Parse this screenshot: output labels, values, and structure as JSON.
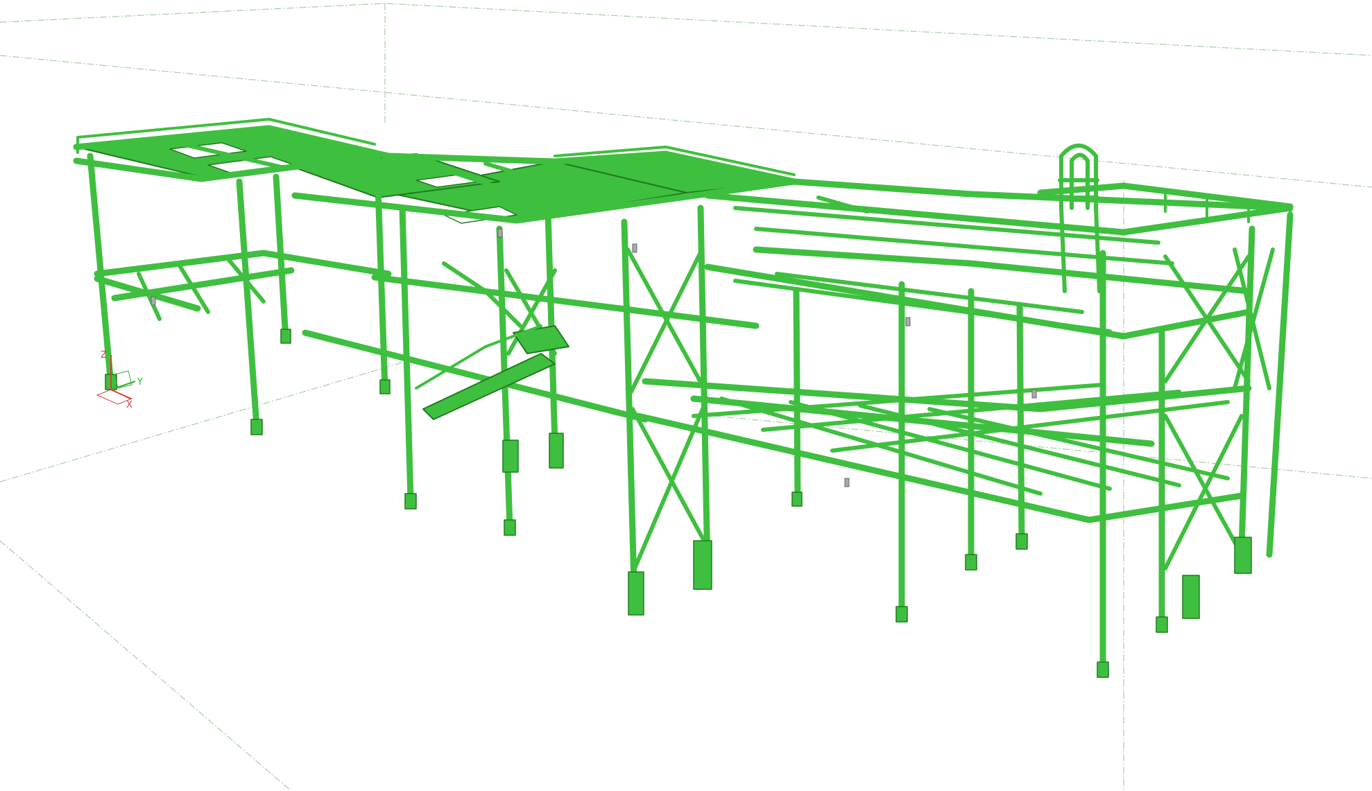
{
  "viewport": {
    "background": "#ffffff",
    "model_color": "#3fbf3f",
    "model_edge_color": "#1f7a1f",
    "model_shade_color": "#2e9e2e",
    "bounding_box_color": "#a6cca6"
  },
  "axis_triad": {
    "z_label": "Z",
    "y_label": "Y",
    "x_label": "X",
    "z_color": "#d04040",
    "y_color": "#30b030",
    "x_color": "#d04040"
  }
}
